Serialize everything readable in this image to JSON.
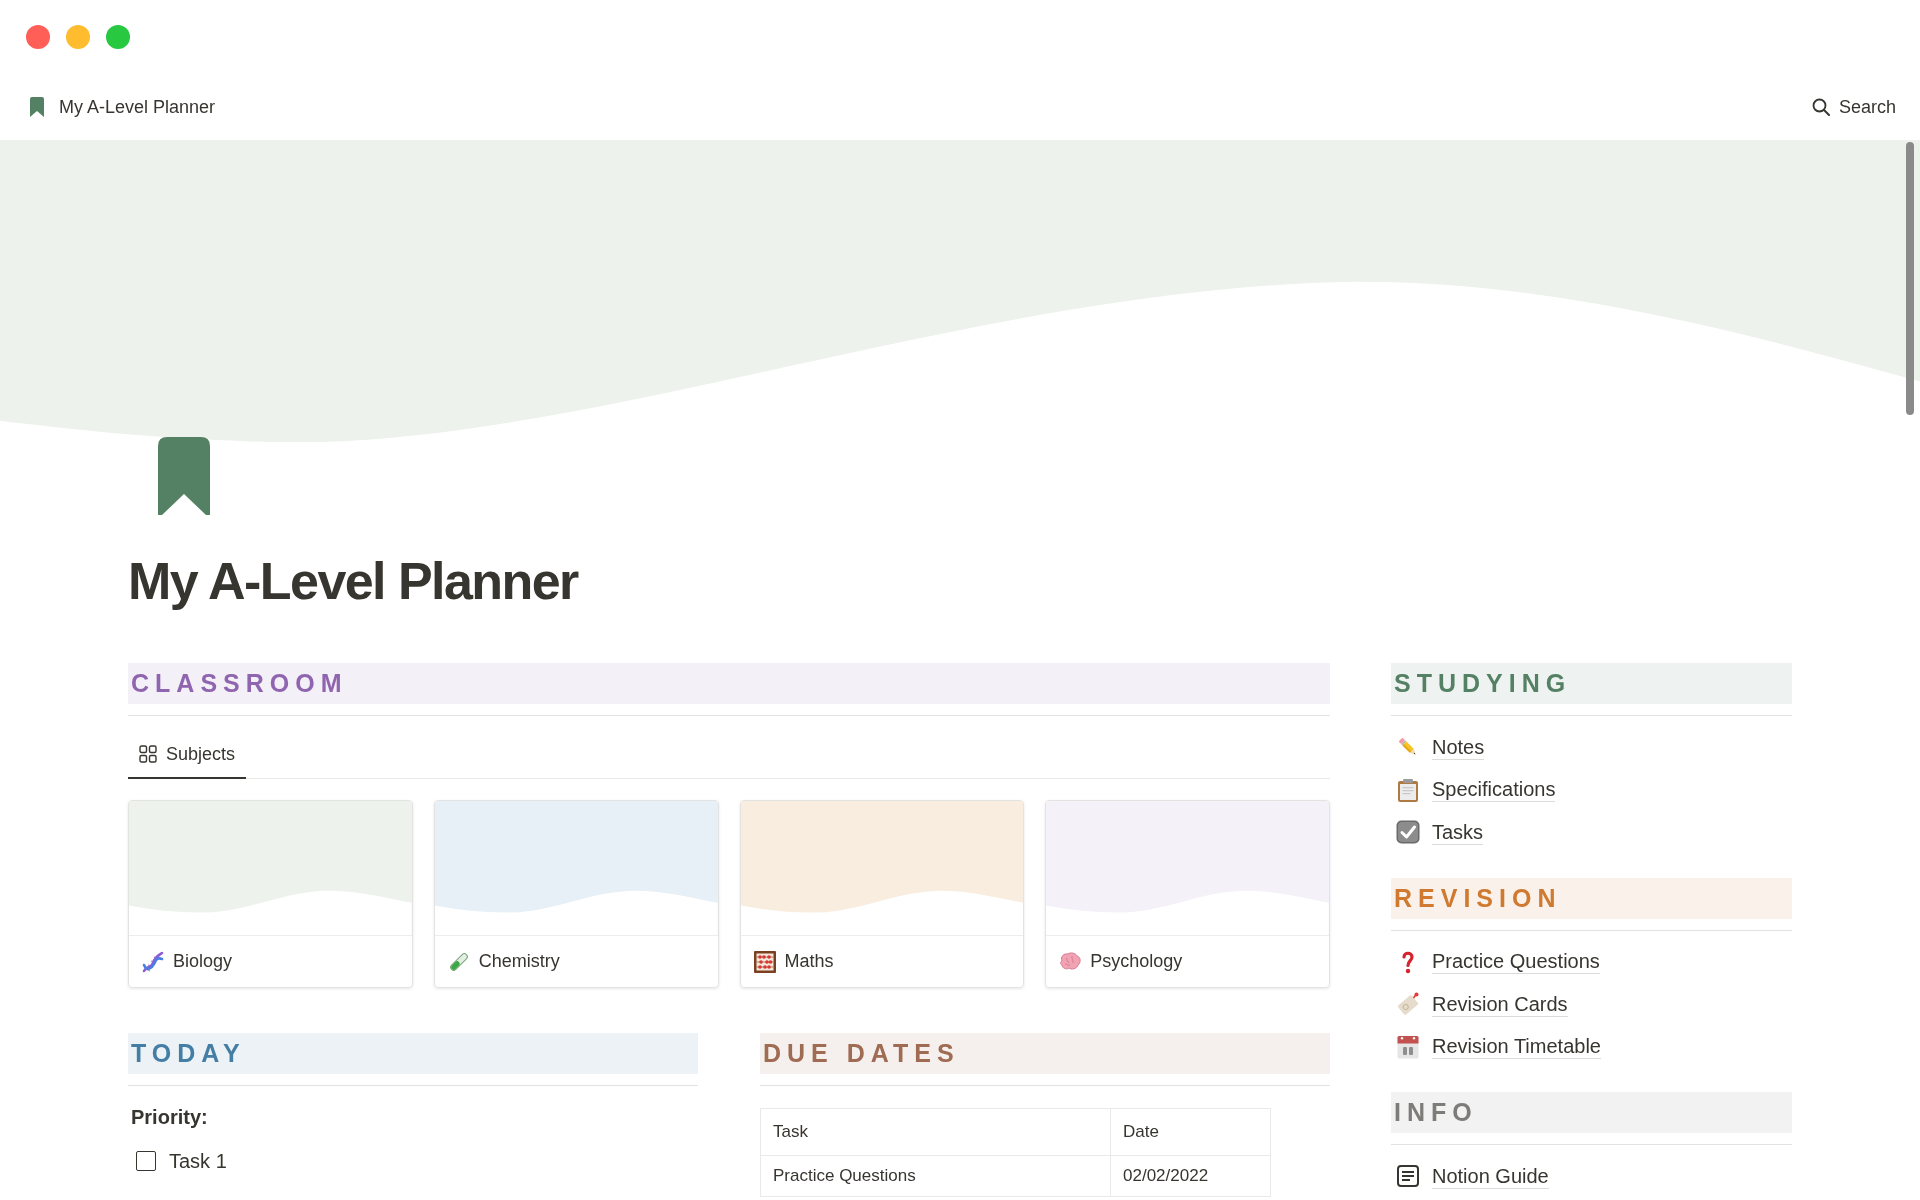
{
  "window": {
    "breadcrumb": "My A-Level Planner",
    "search": "Search"
  },
  "page": {
    "title": "My A-Level Planner"
  },
  "classroom": {
    "heading": "CLASSROOM",
    "color": "#9065b0",
    "tabs": [
      {
        "label": "Subjects",
        "selected": true
      }
    ],
    "subjects": [
      {
        "name": "Biology",
        "color": "#edf3ec"
      },
      {
        "name": "Chemistry",
        "color": "#e7f0f7"
      },
      {
        "name": "Maths",
        "color": "#f9ede0"
      },
      {
        "name": "Psychology",
        "color": "#f4f2f8"
      }
    ]
  },
  "today": {
    "heading": "TODAY",
    "color": "#447ea5",
    "priority_label": "Priority:",
    "tasks": [
      {
        "label": "Task 1",
        "checked": false
      }
    ]
  },
  "due_dates": {
    "heading": "DUE DATES",
    "color": "#9f6b53",
    "table": {
      "columns": [
        "Task",
        "Date"
      ],
      "rows": [
        [
          "Practice Questions",
          "02/02/2022"
        ]
      ]
    }
  },
  "sidebar": [
    {
      "heading": "STUDYING",
      "color": "#548164",
      "links": [
        "Notes",
        "Specifications",
        "Tasks"
      ]
    },
    {
      "heading": "REVISION",
      "color": "#cf7a30",
      "links": [
        "Practice Questions",
        "Revision Cards",
        "Revision Timetable"
      ]
    },
    {
      "heading": "INFO",
      "color": "#7d7c78",
      "links": [
        "Notion Guide"
      ]
    }
  ]
}
